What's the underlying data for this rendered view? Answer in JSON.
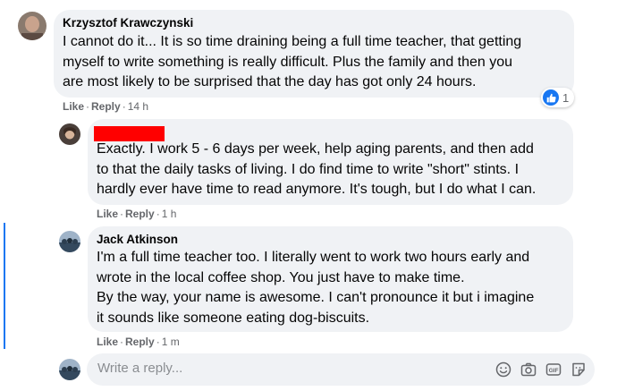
{
  "comments": [
    {
      "author": "Krzysztof Krawczynski",
      "text": "I cannot do it... It is so time draining being a full time teacher, that getting\nmyself to write something is really difficult. Plus the family and then you\nare most likely to be surprised that the day has got only 24 hours.",
      "like_label": "Like",
      "reply_label": "Reply",
      "time": "14 h",
      "reaction_count": "1"
    },
    {
      "author": "",
      "text": "Exactly. I work 5 - 6 days per week, help aging parents, and then add\nto that the daily tasks of living. I do find time to write \"short\" stints. I\nhardly ever have time to read anymore. It's tough, but I do what I can.",
      "like_label": "Like",
      "reply_label": "Reply",
      "time": "1 h"
    },
    {
      "author": "Jack Atkinson",
      "text": "I'm a full time teacher too. I literally went to work two hours early and\nwrote in the local coffee shop. You just have to make time.\nBy the way, your name is awesome. I can't pronounce it but i imagine\nit sounds like someone eating dog-biscuits.",
      "like_label": "Like",
      "reply_label": "Reply",
      "time": "1 m"
    }
  ],
  "reply_box": {
    "placeholder": "Write a reply...",
    "icons": [
      "emoji-icon",
      "camera-icon",
      "gif-icon",
      "sticker-icon"
    ]
  },
  "colors": {
    "accent": "#1877f2",
    "bubble": "#f0f2f5",
    "meta": "#65676b",
    "redaction": "#ff0000"
  }
}
